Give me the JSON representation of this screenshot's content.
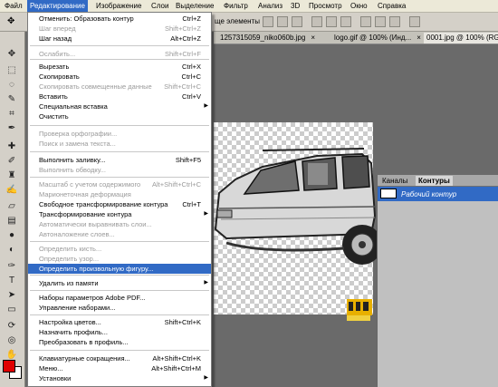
{
  "menubar": {
    "items": [
      "Файл",
      "Редактирование",
      "Изображение",
      "Слои",
      "Выделение",
      "Фильтр",
      "Анализ",
      "3D",
      "Просмотр",
      "Окно",
      "Справка"
    ]
  },
  "options_bar": {
    "fragment": "ще элементы"
  },
  "doc_tabs": [
    {
      "label": "1257315059_niko060b.jpg",
      "close": "×"
    },
    {
      "label": "logo.gif @ 100% (Инд...",
      "close": "×"
    },
    {
      "label": "0001.jpg @ 100% (RGB",
      "close": ""
    }
  ],
  "edit_menu": {
    "items": [
      {
        "label": "Отменить: Образовать контур",
        "shortcut": "Ctrl+Z",
        "state": "normal"
      },
      {
        "label": "Шаг вперед",
        "shortcut": "Shift+Ctrl+Z",
        "state": "disabled"
      },
      {
        "label": "Шаг назад",
        "shortcut": "Alt+Ctrl+Z",
        "state": "normal"
      },
      {
        "label": "Ослабить...",
        "shortcut": "Shift+Ctrl+F",
        "state": "disabled"
      },
      {
        "label": "Вырезать",
        "shortcut": "Ctrl+X",
        "state": "normal"
      },
      {
        "label": "Скопировать",
        "shortcut": "Ctrl+C",
        "state": "normal"
      },
      {
        "label": "Скопировать совмещенные данные",
        "shortcut": "Shift+Ctrl+C",
        "state": "disabled"
      },
      {
        "label": "Вставить",
        "shortcut": "Ctrl+V",
        "state": "normal"
      },
      {
        "label": "Специальная вставка",
        "shortcut": "",
        "state": "normal",
        "submenu": true
      },
      {
        "label": "Очистить",
        "shortcut": "",
        "state": "normal"
      },
      {
        "label": "Проверка орфографии...",
        "shortcut": "",
        "state": "disabled"
      },
      {
        "label": "Поиск и замена текста...",
        "shortcut": "",
        "state": "disabled"
      },
      {
        "label": "Выполнить заливку...",
        "shortcut": "Shift+F5",
        "state": "normal"
      },
      {
        "label": "Выполнить обводку...",
        "shortcut": "",
        "state": "disabled"
      },
      {
        "label": "Масштаб с учетом содержимого",
        "shortcut": "Alt+Shift+Ctrl+C",
        "state": "disabled"
      },
      {
        "label": "Марионеточная деформация",
        "shortcut": "",
        "state": "disabled"
      },
      {
        "label": "Свободное трансформирование контура",
        "shortcut": "Ctrl+T",
        "state": "normal"
      },
      {
        "label": "Трансформирование контура",
        "shortcut": "",
        "state": "normal",
        "submenu": true
      },
      {
        "label": "Автоматически выравнивать слои...",
        "shortcut": "",
        "state": "disabled"
      },
      {
        "label": "Автоналожение слоев...",
        "shortcut": "",
        "state": "disabled"
      },
      {
        "label": "Определить кисть...",
        "shortcut": "",
        "state": "disabled"
      },
      {
        "label": "Определить узор...",
        "shortcut": "",
        "state": "disabled"
      },
      {
        "label": "Определить произвольную фигуру...",
        "shortcut": "",
        "state": "highlighted"
      },
      {
        "label": "Удалить из памяти",
        "shortcut": "",
        "state": "normal",
        "submenu": true
      },
      {
        "label": "Наборы параметров Adobe PDF...",
        "shortcut": "",
        "state": "normal"
      },
      {
        "label": "Управление наборами...",
        "shortcut": "",
        "state": "normal"
      },
      {
        "label": "Настройка цветов...",
        "shortcut": "Shift+Ctrl+K",
        "state": "normal"
      },
      {
        "label": "Назначить профиль...",
        "shortcut": "",
        "state": "normal"
      },
      {
        "label": "Преобразовать в профиль...",
        "shortcut": "",
        "state": "normal"
      },
      {
        "label": "Клавиатурные сокращения...",
        "shortcut": "Alt+Shift+Ctrl+K",
        "state": "normal"
      },
      {
        "label": "Меню...",
        "shortcut": "Alt+Shift+Ctrl+M",
        "state": "normal"
      },
      {
        "label": "Установки",
        "shortcut": "",
        "state": "normal",
        "submenu": true
      }
    ]
  },
  "paths_panel": {
    "tabs": [
      "Каналы",
      "Контуры"
    ],
    "active_tab": "Контуры",
    "rows": [
      {
        "label": "Рабочий контур",
        "selected": true
      }
    ]
  },
  "colors": {
    "accent": "#316ac5",
    "foreground_swatch": "#e00000",
    "background_swatch": "#ffffff"
  },
  "icons": {
    "submenu": "submenu-arrow-icon",
    "tools": [
      "move-tool-icon",
      "marquee-tool-icon",
      "lasso-tool-icon",
      "quick-select-icon",
      "crop-tool-icon",
      "eyedropper-icon",
      "healing-brush-icon",
      "brush-tool-icon",
      "clone-stamp-icon",
      "history-brush-icon",
      "eraser-tool-icon",
      "gradient-tool-icon",
      "blur-tool-icon",
      "dodge-tool-icon",
      "pen-tool-icon",
      "type-tool-icon",
      "path-select-icon",
      "shape-tool-icon",
      "3d-rotate-icon",
      "3d-orbit-icon",
      "hand-tool-icon",
      "zoom-tool-icon"
    ]
  }
}
